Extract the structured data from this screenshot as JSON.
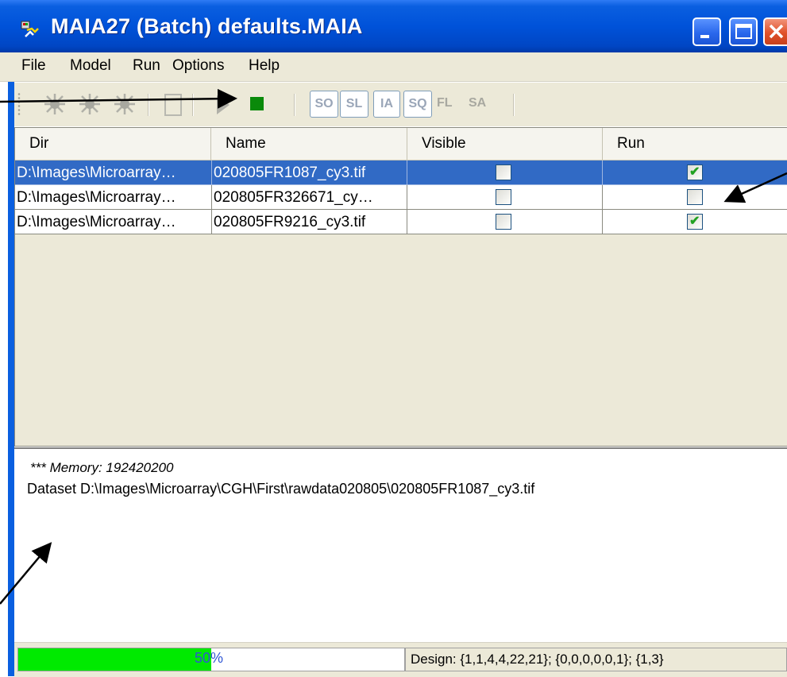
{
  "window": {
    "title": "MAIA27 (Batch) defaults.MAIA"
  },
  "menu": {
    "items": [
      {
        "label": "File"
      },
      {
        "label": "Model"
      },
      {
        "label": "Run"
      },
      {
        "label": "Options"
      },
      {
        "label": "Help"
      }
    ]
  },
  "toolbar": {
    "modes": [
      "SO",
      "SL",
      "IA",
      "SQ"
    ],
    "disabled_modes": [
      "FL",
      "SA"
    ],
    "stop_color": "#0a8a0a"
  },
  "grid": {
    "columns": [
      "Dir",
      "Name",
      "Visible",
      "Run"
    ],
    "rows": [
      {
        "dir": "D:\\Images\\Microarray…",
        "name": "020805FR1087_cy3.tif",
        "visible": false,
        "run": true,
        "selected": true
      },
      {
        "dir": "D:\\Images\\Microarray…",
        "name": "020805FR326671_cy…",
        "visible": false,
        "run": false,
        "selected": false
      },
      {
        "dir": "D:\\Images\\Microarray…",
        "name": "020805FR9216_cy3.tif",
        "visible": false,
        "run": true,
        "selected": false
      }
    ]
  },
  "log": {
    "memory_line": "*** Memory: 192420200",
    "dataset_line": "Dataset D:\\Images\\Microarray\\CGH\\First\\rawdata020805\\020805FR1087_cy3.tif"
  },
  "status": {
    "progress_percent": 50,
    "progress_label": "50%",
    "design_text": "Design: {1,1,4,4,22,21}; {0,0,0,0,0,1}; {1,3}"
  },
  "colors": {
    "titlebar": "#0052d9",
    "selection": "#316ac5",
    "progress": "#00ea00",
    "checkmark": "#21a121"
  }
}
